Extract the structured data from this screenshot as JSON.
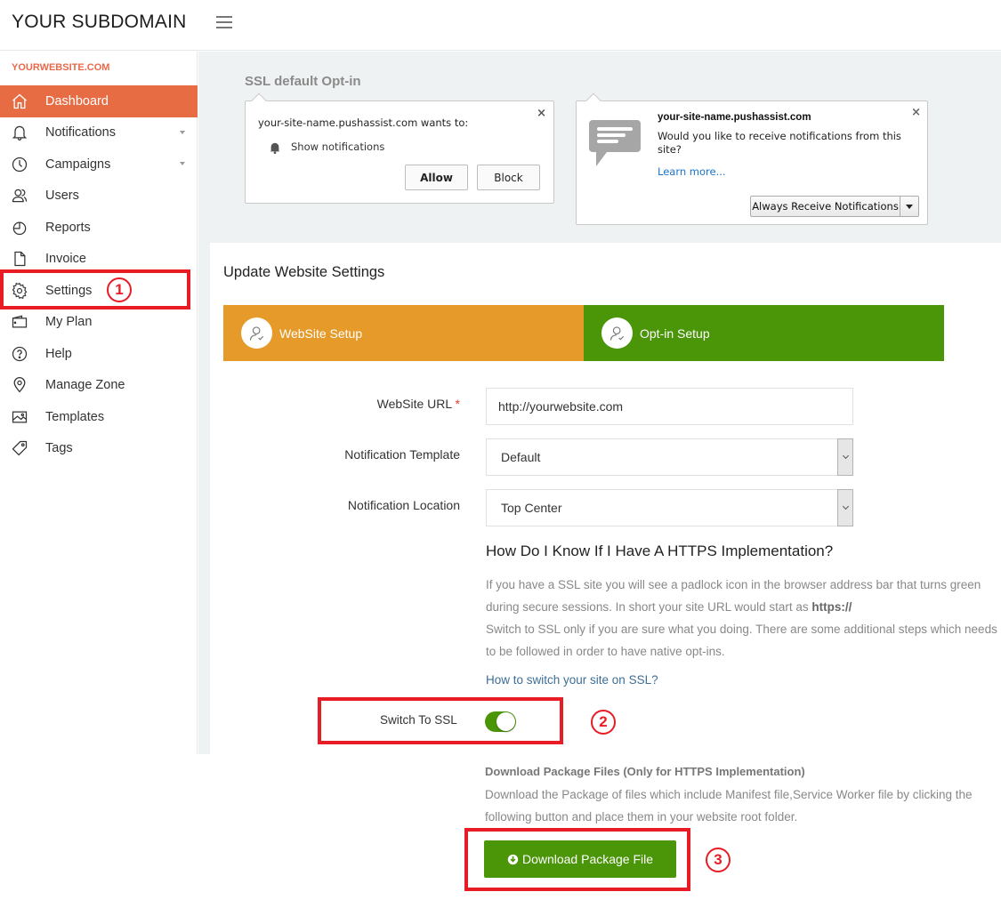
{
  "header": {
    "brand": "YOUR SUBDOMAIN",
    "menu_icon": "hamburger-icon"
  },
  "sidebar": {
    "site_label": "YOURWEBSITE.COM",
    "items": [
      {
        "label": "Dashboard",
        "icon": "home-icon",
        "active": true,
        "has_caret": false
      },
      {
        "label": "Notifications",
        "icon": "bell-icon",
        "active": false,
        "has_caret": true
      },
      {
        "label": "Campaigns",
        "icon": "clock-icon",
        "active": false,
        "has_caret": true
      },
      {
        "label": "Users",
        "icon": "users-icon",
        "active": false,
        "has_caret": false
      },
      {
        "label": "Reports",
        "icon": "pie-chart-icon",
        "active": false,
        "has_caret": false
      },
      {
        "label": "Invoice",
        "icon": "document-icon",
        "active": false,
        "has_caret": false
      },
      {
        "label": "Settings",
        "icon": "gear-icon",
        "active": false,
        "has_caret": false
      },
      {
        "label": "My Plan",
        "icon": "wallet-icon",
        "active": false,
        "has_caret": false
      },
      {
        "label": "Help",
        "icon": "help-icon",
        "active": false,
        "has_caret": false
      },
      {
        "label": "Manage Zone",
        "icon": "location-pin-icon",
        "active": false,
        "has_caret": false
      },
      {
        "label": "Templates",
        "icon": "image-icon",
        "active": false,
        "has_caret": false
      },
      {
        "label": "Tags",
        "icon": "tag-icon",
        "active": false,
        "has_caret": false
      }
    ]
  },
  "ssl_optin": {
    "title": "SSL default Opt-in",
    "chrome_prompt": {
      "title": "your-site-name.pushassist.com wants to:",
      "permission": "Show notifications",
      "allow_label": "Allow",
      "block_label": "Block",
      "close": "×"
    },
    "firefox_prompt": {
      "host": "your-site-name.pushassist.com",
      "question": "Would you like to receive notifications from this site?",
      "learn_more": "Learn more...",
      "action_label": "Always Receive Notifications",
      "close": "×"
    }
  },
  "settings": {
    "title": "Update Website Settings",
    "steps": [
      {
        "label": "WebSite Setup",
        "color": "#e59a2a"
      },
      {
        "label": "Opt-in Setup",
        "color": "#4a9508"
      }
    ],
    "fields": {
      "website_url_label": "WebSite URL",
      "required_mark": "*",
      "website_url_value": "http://yourwebsite.com",
      "template_label": "Notification Template",
      "template_value": "Default",
      "location_label": "Notification Location",
      "location_value": "Top Center"
    },
    "https": {
      "title": "How Do I Know If I Have A HTTPS Implementation?",
      "desc_1": "If you have a SSL site you will see a padlock icon in the browser address bar that turns green during secure sessions. In short your site URL would start as ",
      "desc_bold": "https://",
      "desc_2": "Switch to SSL only if you are sure what you doing. There are some additional steps which needs to be followed in order to have native opt-ins.",
      "link": "How to switch your site on SSL?"
    },
    "ssl_switch": {
      "label": "Switch To SSL",
      "on": true
    },
    "download": {
      "title": "Download Package Files (Only for HTTPS Implementation)",
      "desc": "Download the Package of files which include Manifest file,Service Worker file by clicking the following button and place them in your website root folder.",
      "button_label": "Download Package File"
    }
  },
  "annotations": [
    {
      "number": "1"
    },
    {
      "number": "2"
    },
    {
      "number": "3"
    }
  ],
  "colors": {
    "accent": "#e86c43",
    "orange_step": "#e59a2a",
    "green": "#4a9508",
    "annotation_red": "#e81c24"
  }
}
